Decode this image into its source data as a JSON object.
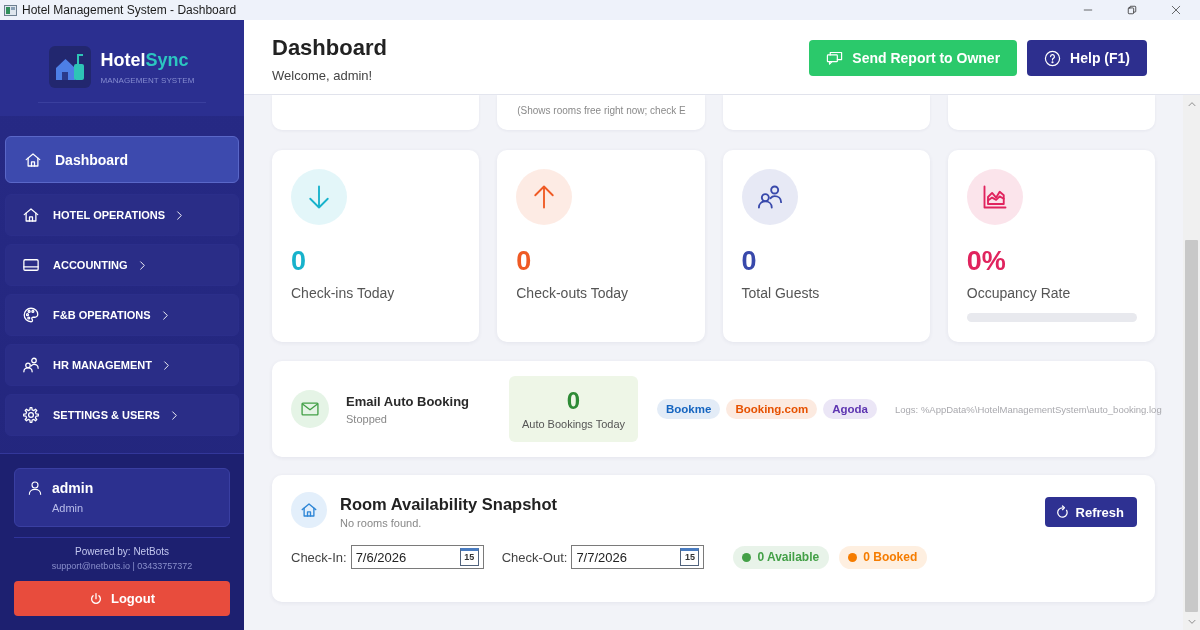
{
  "window": {
    "title": "Hotel Management System - Dashboard"
  },
  "sidebar": {
    "brand": {
      "name_part_1": "Hotel",
      "name_part_2": "Sync",
      "subtitle": "MANAGEMENT SYSTEM"
    },
    "nav": [
      {
        "label": "Dashboard",
        "kind": "link",
        "selected": true
      },
      {
        "label": "HOTEL OPERATIONS",
        "kind": "group",
        "selected": false
      },
      {
        "label": "ACCOUNTING",
        "kind": "group",
        "selected": false
      },
      {
        "label": "F&B OPERATIONS",
        "kind": "group",
        "selected": false
      },
      {
        "label": "HR MANAGEMENT",
        "kind": "group",
        "selected": false
      },
      {
        "label": "SETTINGS & USERS",
        "kind": "group",
        "selected": false
      }
    ],
    "user": {
      "name": "admin",
      "role": "Admin"
    },
    "footer": {
      "powered_by": "Powered by: NetBots",
      "contact": "support@netbots.io | 03433757372"
    },
    "logout": "Logout"
  },
  "header": {
    "title": "Dashboard",
    "welcome": "Welcome, admin!",
    "buttons": [
      {
        "label": "Send Report to Owner",
        "kind": "report"
      },
      {
        "label": "Help (F1)",
        "kind": "help"
      }
    ]
  },
  "partial_cards": [
    {
      "kind": "blank"
    },
    {
      "kind": "note",
      "note": "(Shows rooms free right now; check E"
    },
    {
      "kind": "blank"
    },
    {
      "kind": "blank"
    }
  ],
  "stats": [
    {
      "value": "0",
      "label": "Check-ins Today",
      "kind": "plain",
      "color": "#17b2cb"
    },
    {
      "value": "0",
      "label": "Check-outs Today",
      "kind": "plain",
      "color": "#ef5a24"
    },
    {
      "value": "0",
      "label": "Total Guests",
      "kind": "plain",
      "color": "#3949ab"
    },
    {
      "value": "0%",
      "label": "Occupancy Rate",
      "kind": "progress",
      "color": "#e0245e",
      "level": 0
    }
  ],
  "email_booking": {
    "title": "Email Auto Booking",
    "status": "Stopped",
    "counter": {
      "value": "0",
      "label": "Auto Bookings Today"
    },
    "channels": [
      {
        "label": "Bookme",
        "color": "#1565c0"
      },
      {
        "label": "Booking.com",
        "color": "#e65100"
      },
      {
        "label": "Agoda",
        "color": "#5e35b1"
      }
    ],
    "log_path": "Logs: %AppData%\\HotelManagementSystem\\auto_booking.log"
  },
  "room_availability": {
    "title": "Room Availability Snapshot",
    "subtitle": "No rooms found.",
    "refresh": "Refresh",
    "dates": [
      {
        "label": "Check-In:",
        "value": "7/6/2026",
        "calendar_day": "15"
      },
      {
        "label": "Check-Out:",
        "value": "7/7/2026",
        "calendar_day": "15"
      }
    ],
    "counts": [
      {
        "label": "0 Available",
        "color": "#43a047"
      },
      {
        "label": "0 Booked",
        "color": "#f57c00"
      }
    ]
  }
}
